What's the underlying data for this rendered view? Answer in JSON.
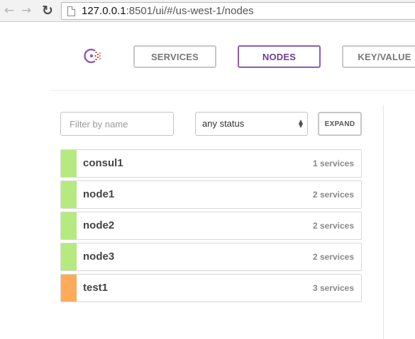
{
  "browser": {
    "url_host": "127.0.0.1",
    "url_path": ":8501/ui/#/us-west-1/nodes"
  },
  "header": {
    "tabs": [
      {
        "label": "SERVICES",
        "active": false
      },
      {
        "label": "NODES",
        "active": true
      },
      {
        "label": "KEY/VALUE",
        "active": false
      }
    ]
  },
  "filters": {
    "search_placeholder": "Filter by name",
    "search_value": "",
    "status_selected": "any status",
    "expand_label": "EXPAND"
  },
  "colors": {
    "passing": "#b4ea80",
    "warning": "#fdaa5b",
    "accent": "#8e5bb0"
  },
  "nodes": [
    {
      "name": "consul1",
      "services": "1 services",
      "status": "passing"
    },
    {
      "name": "node1",
      "services": "2 services",
      "status": "passing"
    },
    {
      "name": "node2",
      "services": "2 services",
      "status": "passing"
    },
    {
      "name": "node3",
      "services": "2 services",
      "status": "passing"
    },
    {
      "name": "test1",
      "services": "3 services",
      "status": "warning"
    }
  ]
}
